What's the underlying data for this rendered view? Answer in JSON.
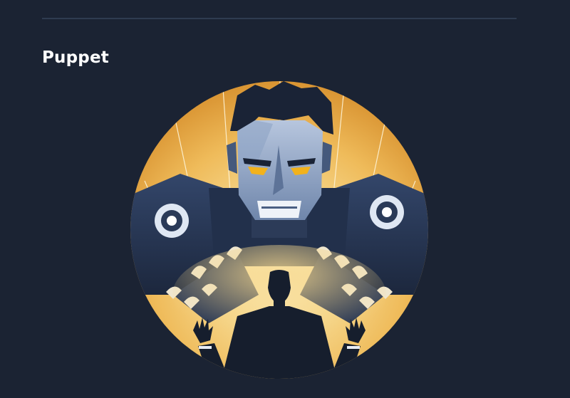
{
  "section": {
    "title": "Puppet"
  },
  "illustration": {
    "subject": "robot-puppeteer-illustration",
    "colors": {
      "background": "#1b2333",
      "glow_center": "#fbe7a8",
      "glow_mid": "#f2c266",
      "glow_edge": "#e4a13e",
      "robot_dark": "#1f2c44",
      "robot_mid": "#3b4f72",
      "robot_light": "#8aa2c6",
      "face_plate": "#d7deea",
      "eye": "#f2b21c",
      "claw": "#efe6cf",
      "silhouette": "#161e2d"
    }
  }
}
